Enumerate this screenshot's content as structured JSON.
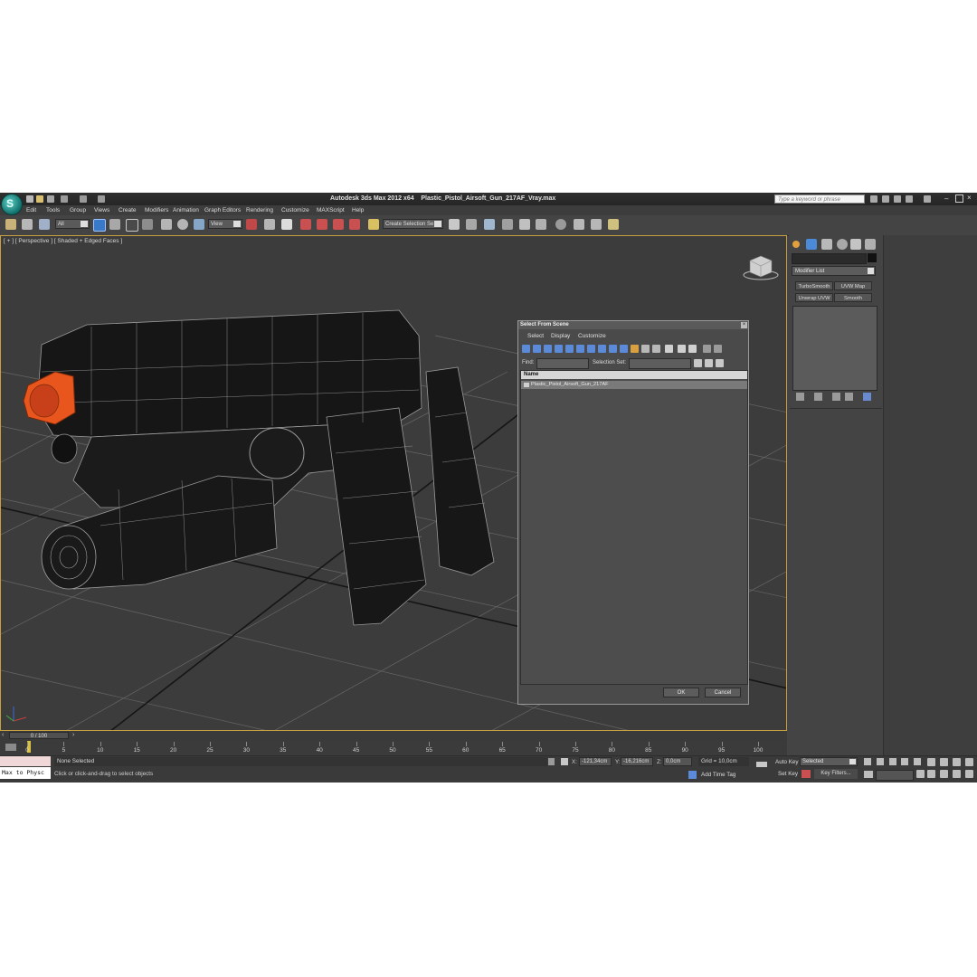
{
  "app": {
    "title": "Autodesk 3ds Max  2012 x64",
    "file": "Plastic_Pistol_Airsoft_Gun_217AF_Vray.max",
    "search_placeholder": "Type a keyword or phrase",
    "logo": "3ds-max-logo"
  },
  "menu": [
    "Edit",
    "Tools",
    "Group",
    "Views",
    "Create",
    "Modifiers",
    "Animation",
    "Graph Editors",
    "Rendering",
    "Customize",
    "MAXScript",
    "Help"
  ],
  "toolbar": {
    "filter_value": "All",
    "ref_coord_value": "View",
    "selection_set_value": "Create Selection Se"
  },
  "viewport": {
    "label": "[ + ] [ Perspective ] [ Shaded + Edged Faces ]",
    "object_accent": "#e8561e",
    "grid_color": "#8a8a8a",
    "border_color": "#c8a040"
  },
  "command_panel": {
    "modifier_list": "Modifier List",
    "buttons": [
      "TurboSmooth",
      "UVW Map",
      "Unwrap UVW",
      "Smooth"
    ]
  },
  "dialog": {
    "title": "Select From Scene",
    "menu": [
      "Select",
      "Display",
      "Customize"
    ],
    "find_label": "Find:",
    "selection_set_label": "Selection Set:",
    "column_header": "Name",
    "items": [
      "Plastic_Pistol_Airsoft_Gun_217AF"
    ],
    "ok_label": "OK",
    "cancel_label": "Cancel"
  },
  "timeline": {
    "frame_display": "0 / 100",
    "ticks": [
      "0",
      "5",
      "10",
      "15",
      "20",
      "25",
      "30",
      "35",
      "40",
      "45",
      "50",
      "55",
      "60",
      "65",
      "70",
      "75",
      "80",
      "85",
      "90",
      "95",
      "100"
    ]
  },
  "status": {
    "maxscript_text": "Max to Physc",
    "selection_status": "None Selected",
    "prompt": "Click or click-and-drag to select objects",
    "x_label": "X:",
    "x_value": "-121,34cm",
    "y_label": "Y:",
    "y_value": "-16,216cm",
    "z_label": "Z:",
    "z_value": "0,0cm",
    "grid": "Grid = 10,0cm",
    "add_time_tag": "Add Time Tag",
    "auto_key": "Auto Key",
    "set_key": "Set Key",
    "key_mode": "Selected",
    "key_filters": "Key Filters..."
  }
}
